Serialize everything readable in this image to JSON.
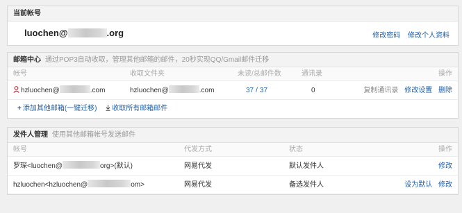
{
  "current_account": {
    "title": "当前帐号",
    "email_prefix": "luochen@",
    "email_suffix": "org",
    "change_password": "修改密码",
    "edit_profile": "修改个人资料"
  },
  "mail_center": {
    "title": "邮箱中心",
    "description": "通过POP3自动收取，管理其他邮箱的邮件，20秒实现QQ/Gmail邮件迁移",
    "columns": [
      "帐号",
      "收取文件夹",
      "未读/总邮件数",
      "通讯录",
      "操作"
    ],
    "rows": [
      {
        "account_prefix": "hzluochen@",
        "account_suffix": ".com",
        "folder_prefix": "hzluochen@",
        "folder_suffix": ".com",
        "unread": "37",
        "count_sep": "/",
        "total": "37",
        "contacts": "0",
        "copy_contacts": "复制通讯录",
        "edit_settings": "修改设置",
        "delete": "删除"
      }
    ],
    "add_mailbox": "添加其他邮箱(一键迁移)",
    "collect_all": "收取所有邮箱邮件"
  },
  "sender_mgmt": {
    "title": "发件人管理",
    "description": "使用其他邮箱帐号发送邮件",
    "columns": [
      "帐号",
      "代发方式",
      "状态",
      "操作"
    ],
    "rows": [
      {
        "account_prefix": "罗琛<luochen@",
        "account_suffix": "org>(默认)",
        "method": "网易代发",
        "status": "默认发件人",
        "edit": "修改"
      },
      {
        "account_prefix": "hzluochen<hzluochen@",
        "account_suffix": "om>",
        "method": "网易代发",
        "status": "备选发件人",
        "set_default": "设为默认",
        "edit": "修改"
      }
    ]
  },
  "colors": {
    "link": "#1e5fa8",
    "header_bg": "#f3f3f3",
    "muted": "#999999"
  }
}
